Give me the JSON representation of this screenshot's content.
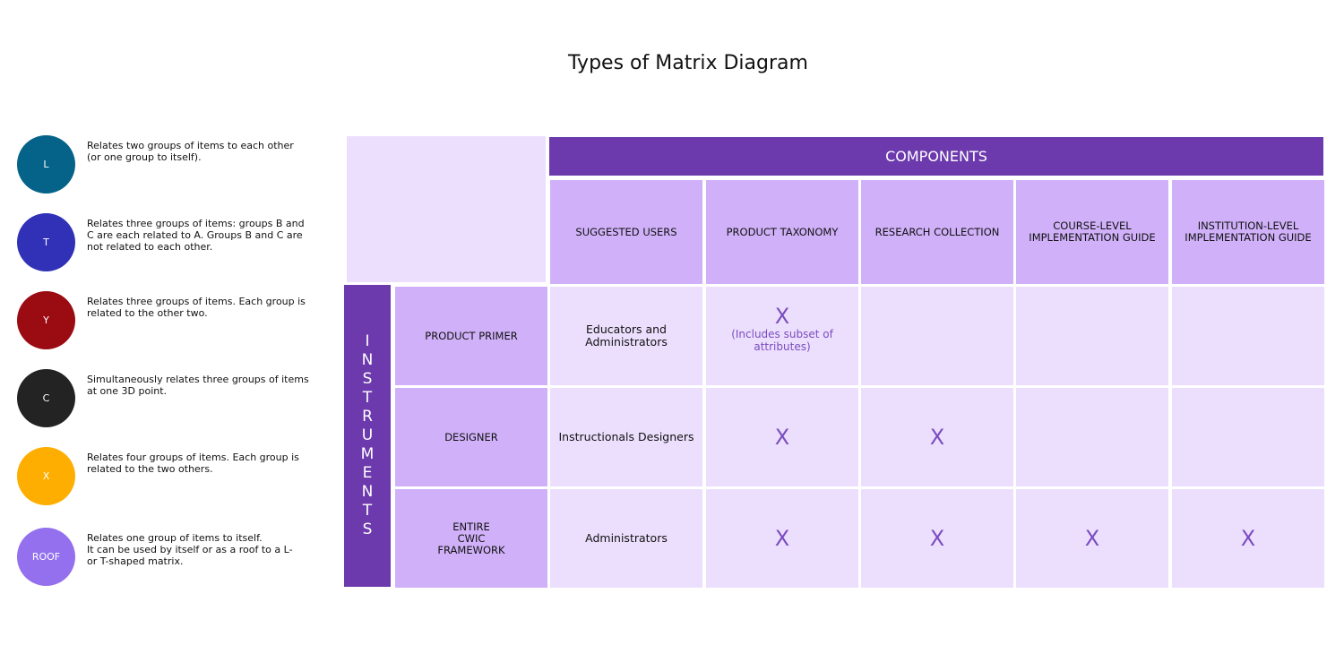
{
  "title": "Types of Matrix Diagram",
  "legend": [
    {
      "label": "L",
      "color": "#056389",
      "description": "Relates two groups of items to each other\n(or one group to itself)."
    },
    {
      "label": "T",
      "color": "#3131b8",
      "description": "Relates three groups of items: groups B and\nC are each related to A. Groups B and C are\nnot related to each other."
    },
    {
      "label": "Y",
      "color": "#9b0b12",
      "description": "Relates three groups of items. Each group is\nrelated to the other two."
    },
    {
      "label": "C",
      "color": "#232323",
      "description": "Simultaneously relates three groups of items\nat one 3D point."
    },
    {
      "label": "X",
      "color": "#fdae00",
      "description": "Relates four groups of items. Each group is\nrelated to the two others."
    },
    {
      "label": "ROOF",
      "color": "#9470ee",
      "description": "Relates one group of items to itself.\nIt can be used by itself or as a roof to a L-\nor T-shaped matrix."
    }
  ],
  "matrix": {
    "column_group": "COMPONENTS",
    "row_group": "INSTRUMENTS",
    "columns": [
      "SUGGESTED USERS",
      "PRODUCT TAXONOMY",
      "RESEARCH COLLECTION",
      "COURSE-LEVEL\nIMPLEMENTATION GUIDE",
      "INSTITUTION-LEVEL\nIMPLEMENTATION GUIDE"
    ],
    "rows": [
      {
        "label": "PRODUCT PRIMER",
        "suggested_users": "Educators and\nAdministrators",
        "cells": [
          {
            "mark": "X",
            "note": "(Includes subset of\nattributes)"
          },
          {
            "mark": "",
            "note": ""
          },
          {
            "mark": "",
            "note": ""
          },
          {
            "mark": "",
            "note": ""
          }
        ]
      },
      {
        "label": "DESIGNER",
        "suggested_users": "Instructionals Designers",
        "cells": [
          {
            "mark": "X",
            "note": ""
          },
          {
            "mark": "X",
            "note": ""
          },
          {
            "mark": "",
            "note": ""
          },
          {
            "mark": "",
            "note": ""
          }
        ]
      },
      {
        "label": "ENTIRE\nCWIC\nFRAMEWORK",
        "suggested_users": "Administrators",
        "cells": [
          {
            "mark": "X",
            "note": ""
          },
          {
            "mark": "X",
            "note": ""
          },
          {
            "mark": "X",
            "note": ""
          },
          {
            "mark": "X",
            "note": ""
          }
        ]
      }
    ]
  }
}
